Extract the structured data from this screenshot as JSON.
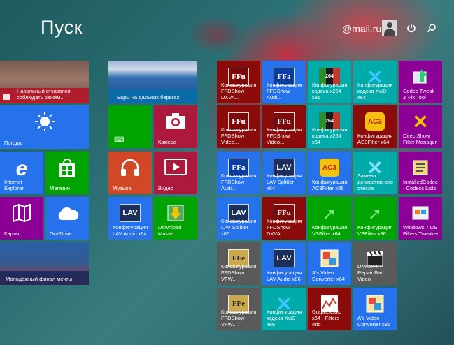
{
  "header": {
    "title": "Пуск",
    "user_name": "@mail.ru",
    "power_icon": "power-icon",
    "search_icon": "search-icon"
  },
  "colors": {
    "green": "#00a300",
    "blue": "#2672ec",
    "magenta": "#ac193d",
    "purple": "#8c0095",
    "orange": "#d24726",
    "teal": "#00aba9",
    "darkred": "#8b0a0a",
    "gray": "#5a5a5a"
  },
  "group1": {
    "news": "Навальный отказался соблюдать режим...",
    "weather": "Погода",
    "ie": "Internet Explorer",
    "store": "Магазин",
    "maps": "Карты",
    "onedrive": "OneDrive",
    "sport": "Молодежный финал мечты"
  },
  "group2": {
    "travel": "Бары на дальних берегах",
    "camera": "Камера",
    "music": "Музыка",
    "video": "Видео",
    "lav_audio": "Конфигурация LAV Audio x64",
    "download_master": "Download Master"
  },
  "group3": {
    "col1": [
      "Конфигурация FFDShow DXVA...",
      "Конфигурация FFDShow Video...",
      "Конфигурация FFDShow Audi...",
      "Конфигурация LAV Splitter x86",
      "Конфигурация FFDShow VFW...",
      "Конфигурация FFDShow VFW..."
    ],
    "col2": [
      "Конфигурация FFDShow Audi...",
      "Конфигурация FFDShow Video...",
      "Конфигурация LAV Splitter x64",
      "Конфигурация FFDShow DXVA...",
      "Конфигурация LAV Audio x86",
      "Конфигурация кодека XviD x86"
    ],
    "col3": [
      "Конфигурация кодека x264 x86",
      "Конфигурация кодека x264 x64",
      "Конфигурация AC3Filter x86",
      "Конфигурация VSFilter x64",
      "A's Video Converter x64",
      "GraphStudio x64 - Filters Info"
    ],
    "col4": [
      "Конфигурация кодека XviD x64",
      "Конфигурация AC3Filter x64",
      "Замена декоративного стекла",
      "Конфигурация VSFilter x86",
      "DivFix++ - Repair Bad Video",
      "A's Video Converter x86"
    ],
    "col5": [
      "Codec Tweak & Fix Tool",
      "DirectShow Filter Manager",
      "InstalledCodec - Codecs Lists",
      "Windows 7 DS Filters Tweaker"
    ]
  },
  "icon_text": {
    "ffu": "FFu",
    "ffa": "FFa",
    "ffe": "FFe",
    "lav": "LAV",
    "x264": "264",
    "ac3": "AC3",
    "xvid": "✕"
  }
}
